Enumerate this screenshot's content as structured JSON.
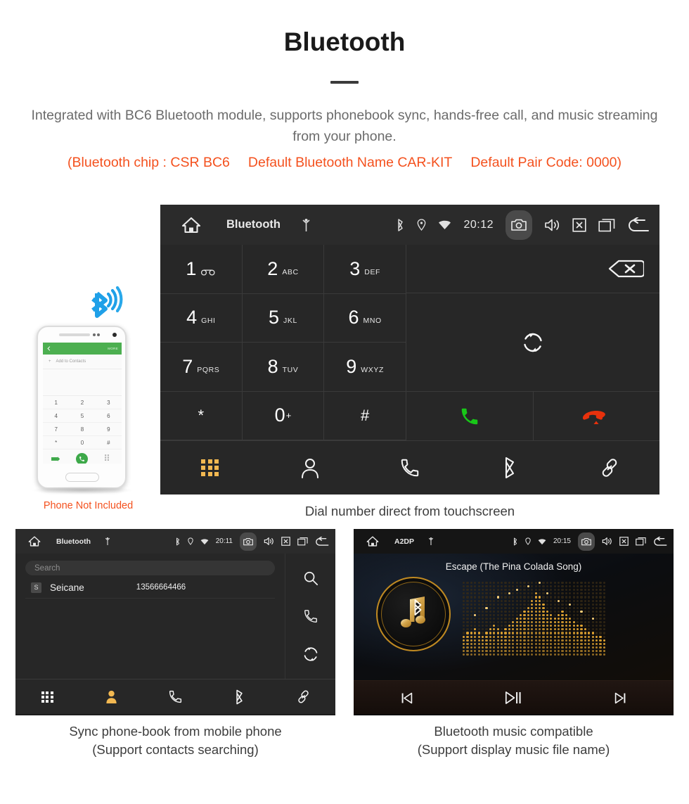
{
  "header": {
    "title": "Bluetooth",
    "lead": "Integrated with BC6 Bluetooth module, supports phonebook sync, hands-free call, and music streaming from your phone.",
    "spec_chip": "(Bluetooth chip : CSR BC6",
    "spec_name": "Default Bluetooth Name CAR-KIT",
    "spec_pair": "Default Pair Code: 0000)",
    "accent_color": "#f4511e",
    "text_color": "#6b6b6b"
  },
  "dialer": {
    "statusbar": {
      "title": "Bluetooth",
      "clock": "20:12",
      "icons_left": [
        "home-icon",
        "usb-icon"
      ],
      "icons_right": [
        "bluetooth-icon",
        "location-icon",
        "wifi-icon",
        "camera-icon",
        "volume-icon",
        "close-box-icon",
        "recents-icon",
        "back-icon"
      ]
    },
    "keys": [
      {
        "digit": "1",
        "letters": "",
        "glyph": "voicemail-icon"
      },
      {
        "digit": "2",
        "letters": "ABC",
        "glyph": ""
      },
      {
        "digit": "3",
        "letters": "DEF",
        "glyph": ""
      },
      {
        "digit": "4",
        "letters": "GHI",
        "glyph": ""
      },
      {
        "digit": "5",
        "letters": "JKL",
        "glyph": ""
      },
      {
        "digit": "6",
        "letters": "MNO",
        "glyph": ""
      },
      {
        "digit": "7",
        "letters": "PQRS",
        "glyph": ""
      },
      {
        "digit": "8",
        "letters": "TUV",
        "glyph": ""
      },
      {
        "digit": "9",
        "letters": "WXYZ",
        "glyph": ""
      },
      {
        "digit": "*",
        "letters": "",
        "glyph": ""
      },
      {
        "digit": "0",
        "letters": "",
        "glyph": "plus-superscript"
      },
      {
        "digit": "#",
        "letters": "",
        "glyph": ""
      }
    ],
    "actions": {
      "backspace": "backspace-icon",
      "sync": "sync-icon",
      "call": "call-icon",
      "hangup": "hangup-icon",
      "call_color": "#18c718",
      "hangup_color": "#e8310c"
    },
    "nav": [
      {
        "name": "keypad",
        "icon": "keypad-icon",
        "active": true
      },
      {
        "name": "contacts",
        "icon": "person-icon",
        "active": false
      },
      {
        "name": "call-log",
        "icon": "phone-icon",
        "active": false
      },
      {
        "name": "bluetooth",
        "icon": "bluetooth-icon",
        "active": false
      },
      {
        "name": "pair",
        "icon": "link-icon",
        "active": false
      }
    ],
    "active_color": "#f2b851",
    "caption": "Dial number direct from touchscreen"
  },
  "phone_mockup": {
    "appbar_more": "MORE",
    "add_contacts": "Add to Contacts",
    "keys": [
      "1",
      "2",
      "3",
      "4",
      "5",
      "6",
      "7",
      "8",
      "9",
      "*",
      "0",
      "#"
    ],
    "not_included": "Phone Not Included",
    "bar_color": "#4caf50"
  },
  "contacts": {
    "statusbar": {
      "title": "Bluetooth",
      "clock": "20:11"
    },
    "search_placeholder": "Search",
    "rows": [
      {
        "badge": "S",
        "name": "Seicane",
        "number": "13566664466"
      }
    ],
    "rail": [
      {
        "name": "search",
        "icon": "search-icon"
      },
      {
        "name": "dial",
        "icon": "phone-icon"
      },
      {
        "name": "sync",
        "icon": "sync-icon"
      }
    ],
    "nav": [
      {
        "name": "keypad",
        "icon": "keypad-icon",
        "active": false
      },
      {
        "name": "contacts",
        "icon": "person-icon",
        "active": true
      },
      {
        "name": "call-log",
        "icon": "phone-icon",
        "active": false
      },
      {
        "name": "bluetooth",
        "icon": "bluetooth-icon",
        "active": false
      },
      {
        "name": "pair",
        "icon": "link-icon",
        "active": false
      }
    ],
    "caption_line1": "Sync phone-book from mobile phone",
    "caption_line2": "(Support contacts searching)"
  },
  "music": {
    "statusbar": {
      "title": "A2DP",
      "clock": "20:15"
    },
    "track_title": "Escape (The Pina Colada Song)",
    "controls": [
      {
        "name": "previous",
        "icon": "skip-previous-icon"
      },
      {
        "name": "play-pause",
        "icon": "play-pause-icon"
      },
      {
        "name": "next",
        "icon": "skip-next-icon"
      }
    ],
    "accent_color": "#c08a22",
    "caption_line1": "Bluetooth music compatible",
    "caption_line2": "(Support display music file name)"
  }
}
